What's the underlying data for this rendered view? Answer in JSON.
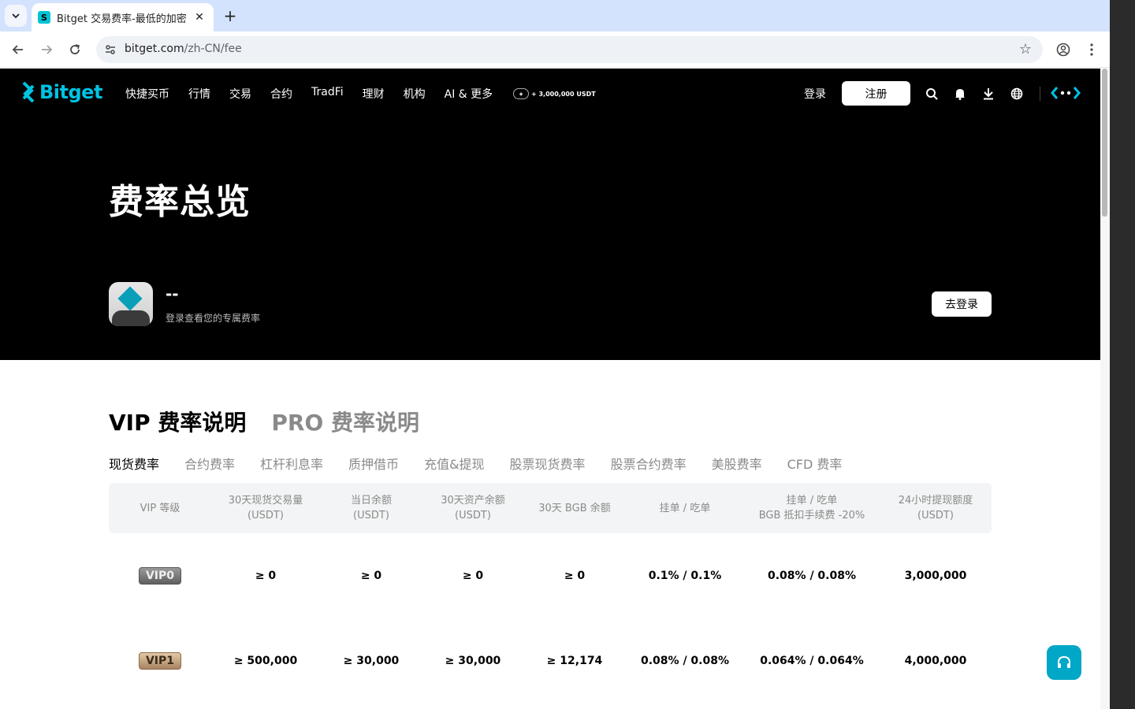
{
  "browser": {
    "tab_title": "Bitget 交易费率-最低的加密",
    "url_domain": "bitget.com",
    "url_path": "/zh-CN/fee"
  },
  "nav": {
    "logo": "Bitget",
    "links": [
      "快捷买币",
      "行情",
      "交易",
      "合约",
      "TradFi",
      "理财",
      "机构",
      "AI & 更多"
    ],
    "promo": "+ 3,000,000 USDT",
    "login": "登录",
    "signup": "注册"
  },
  "hero": {
    "title": "费率总览",
    "user_name": "--",
    "user_sub": "登录查看您的专属费率",
    "goto_login": "去登录"
  },
  "section_tabs": [
    "VIP 费率说明",
    "PRO 费率说明"
  ],
  "sub_tabs": [
    "现货费率",
    "合约费率",
    "杠杆利息率",
    "质押借币",
    "充值&提现",
    "股票现货费率",
    "股票合约费率",
    "美股费率",
    "CFD 费率"
  ],
  "table": {
    "headers": [
      "VIP 等级",
      "30天现货交易量\n(USDT)",
      "当日余额\n(USDT)",
      "30天资产余额\n(USDT)",
      "30天 BGB 余额",
      "挂单 / 吃单",
      "挂单 / 吃单\nBGB 抵扣手续费 -20%",
      "24小时提现额度\n(USDT)"
    ],
    "rows": [
      [
        "VIP0",
        "≥ 0",
        "≥ 0",
        "≥ 0",
        "≥ 0",
        "0.1% / 0.1%",
        "0.08% / 0.08%",
        "3,000,000"
      ],
      [
        "VIP1",
        "≥ 500,000",
        "≥ 30,000",
        "≥ 30,000",
        "≥ 12,174",
        "0.08% / 0.08%",
        "0.064% / 0.064%",
        "4,000,000"
      ]
    ]
  },
  "colors": {
    "brand": "#00c3e3",
    "hero_bg": "#000000",
    "help_button": "#00a7c7"
  }
}
